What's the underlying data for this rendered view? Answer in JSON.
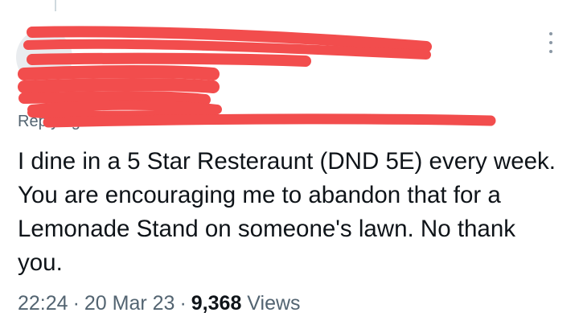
{
  "tweet": {
    "replying_prefix": "Replying to",
    "text": "I dine in a 5 Star Resteraunt (DND 5E) every week. You are encouraging me to abandon that for a Lemonade Stand on someone's lawn. No thank you.",
    "time": "22:24",
    "date": "20 Mar 23",
    "separator": "·",
    "views_count": "9,368",
    "views_label": "Views"
  },
  "icons": {
    "menu": "more-vertical-icon"
  },
  "colors": {
    "redaction": "#f24d4d",
    "text": "#0f1419",
    "muted": "#536471"
  }
}
